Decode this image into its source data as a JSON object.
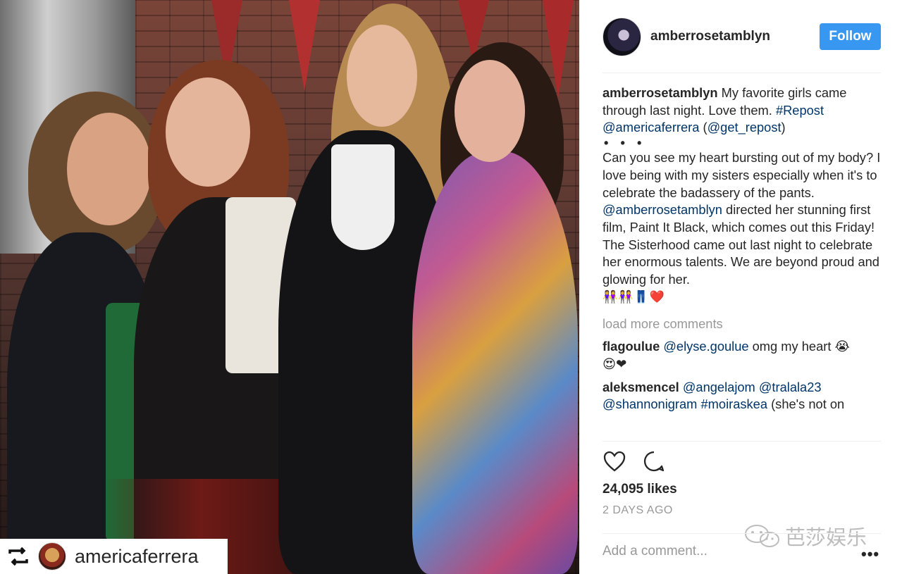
{
  "photo": {
    "repost_username": "americaferrera"
  },
  "header": {
    "username": "amberrosetamblyn",
    "follow_label": "Follow"
  },
  "caption": {
    "username": "amberrosetamblyn",
    "text_1": " My favorite girls came through last night. Love them. ",
    "hashtag_repost": "#Repost",
    "mention_1": "@americaferrera",
    "text_2": " (",
    "mention_2": "@get_repost",
    "text_3": ")",
    "dots": "• • •",
    "text_4": "Can you see my heart bursting out of my body? I love being with my sisters especially when it's to celebrate the badassery of the pants. ",
    "mention_3": "@amberrosetamblyn",
    "text_5": " directed her stunning first film, Paint It Black, which comes out this Friday! The Sisterhood came out last night to celebrate her enormous talents. We are beyond proud and glowing for her.",
    "emojis": "👭👭👖❤️"
  },
  "load_more_label": "load more comments",
  "comments": [
    {
      "username": "flagoulue",
      "mention": "@elyse.goulue",
      "text": " omg my heart 😭",
      "emojis": "😍❤"
    },
    {
      "username": "aleksmencel",
      "mention_1": "@angelajom",
      "mention_2": "@tralala23",
      "mention_3": "@shannonigram",
      "hashtag": "#moiraskea",
      "text": " (she's not on"
    }
  ],
  "likes_label": "24,095 likes",
  "time_label": "2 DAYS AGO",
  "watermark_text": "芭莎娱乐",
  "add_comment_placeholder": "Add a comment...",
  "more_label": "•••",
  "colors": {
    "follow_bg": "#3897f0",
    "mention": "#003569",
    "muted": "#999999"
  }
}
